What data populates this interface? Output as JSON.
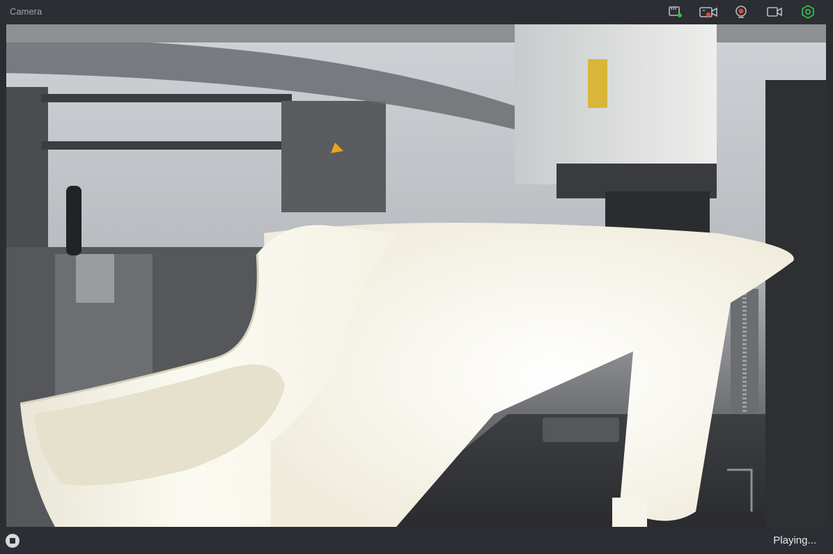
{
  "window": {
    "title": "Camera"
  },
  "toolbar": {
    "icons": [
      "sd-card-icon",
      "timelapse-camera-icon",
      "record-icon",
      "video-camera-icon",
      "settings-gear-icon"
    ],
    "accent_green": "#27c449",
    "record_red": "#e0463a"
  },
  "player": {
    "status": "Playing..."
  }
}
